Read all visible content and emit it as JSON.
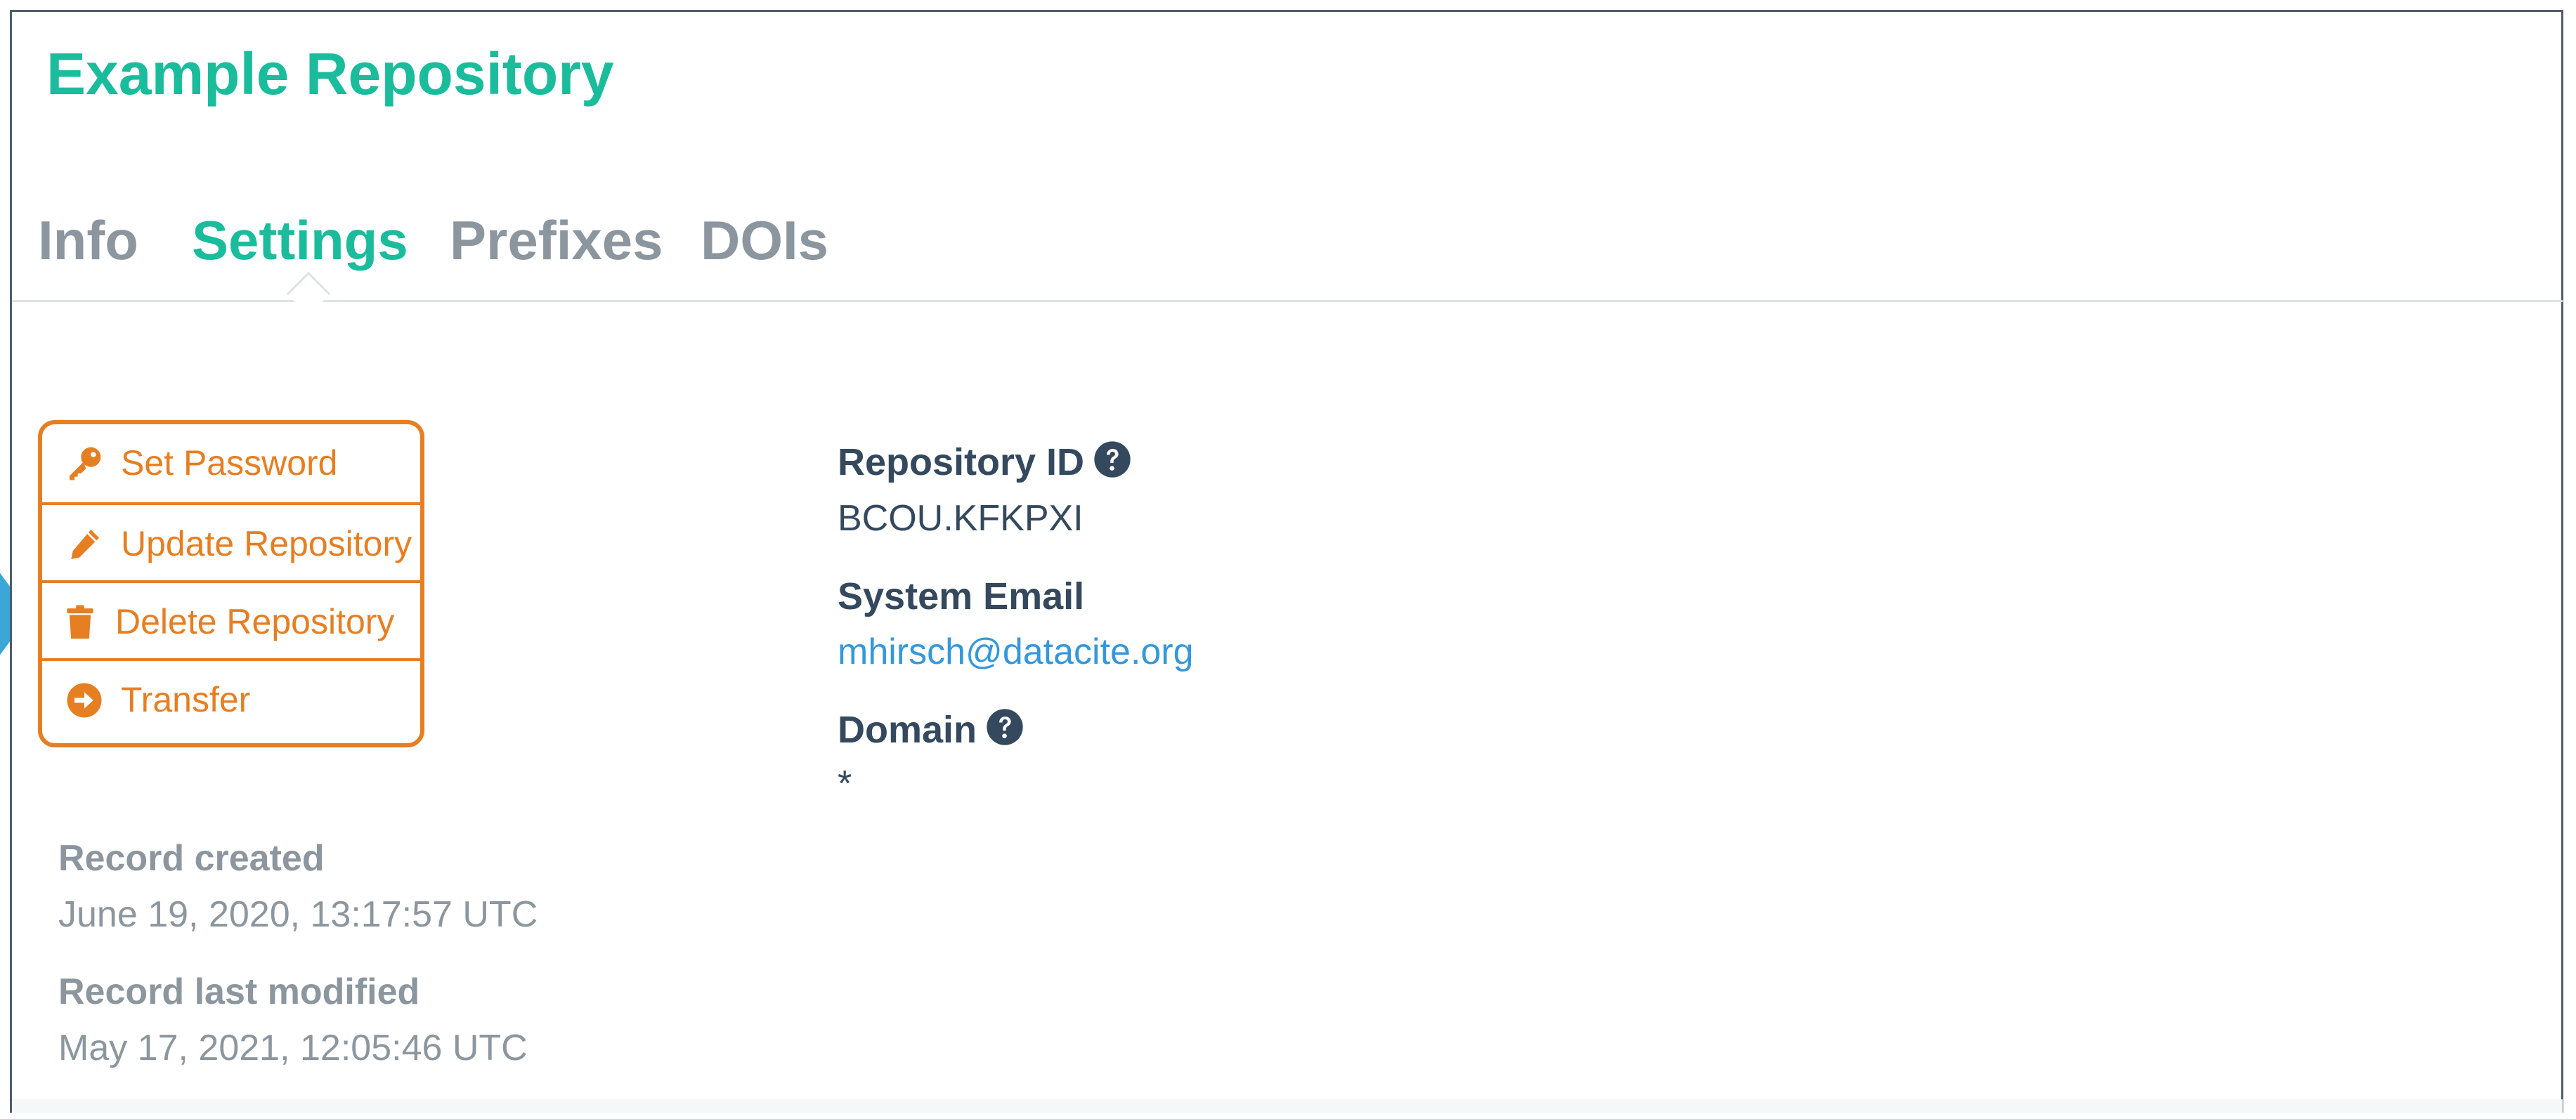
{
  "repository": {
    "title": "Example Repository"
  },
  "tabs": [
    {
      "label": "Info"
    },
    {
      "label": "Settings",
      "active": true
    },
    {
      "label": "Prefixes"
    },
    {
      "label": "DOIs"
    }
  ],
  "actions": [
    {
      "label": "Set Password",
      "icon": "key-icon"
    },
    {
      "label": "Update Repository",
      "icon": "pencil-icon"
    },
    {
      "label": "Delete Repository",
      "icon": "trash-icon"
    },
    {
      "label": "Transfer",
      "icon": "arrow-circle-right-icon"
    }
  ],
  "details": {
    "repository_id_label": "Repository ID",
    "repository_id_value": "BCOU.KFKPXI",
    "system_email_label": "System Email",
    "system_email_value": "mhirsch@datacite.org",
    "domain_label": "Domain",
    "domain_value": "*"
  },
  "record": {
    "created_label": "Record created",
    "created_value": "June 19, 2020, 13:17:57 UTC",
    "modified_label": "Record last modified",
    "modified_value": "May 17, 2021, 12:05:46 UTC"
  },
  "colors": {
    "accent": "#1abc9c",
    "action": "#e67e22",
    "link": "#3498db",
    "text": "#34495e",
    "muted": "#8c969e",
    "pointer": "#3aa7d8"
  }
}
